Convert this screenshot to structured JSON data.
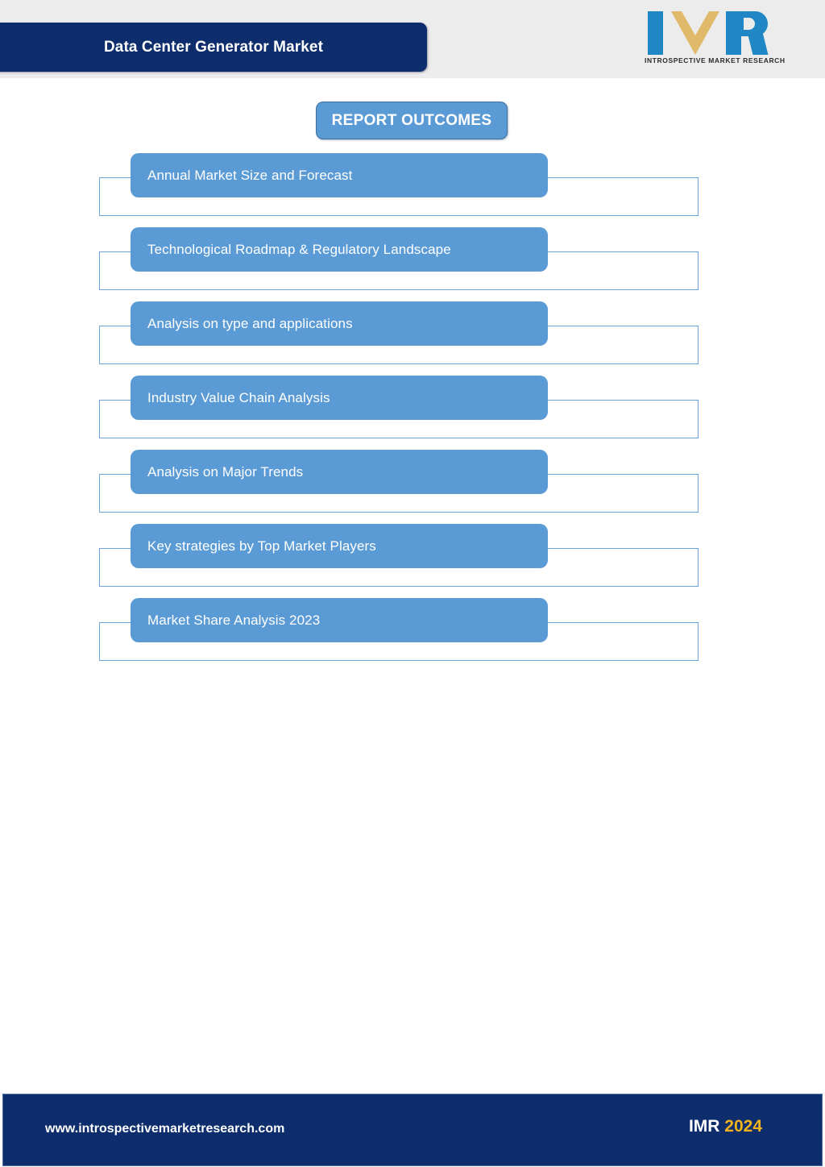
{
  "header": {
    "title": "Data Center Generator Market",
    "band_color": "#ececec",
    "title_color": "#0d2d6c"
  },
  "logo": {
    "letters": "IMR",
    "tagline": "INTROSPECTIVE MARKET RESEARCH",
    "blue": "#2186c4",
    "gold": "#e0b96a"
  },
  "section": {
    "heading": "REPORT OUTCOMES",
    "accent_color": "#5b9bd5"
  },
  "outcomes": [
    {
      "label": "Annual Market Size and Forecast"
    },
    {
      "label": "Technological Roadmap & Regulatory Landscape"
    },
    {
      "label": "Analysis on type and applications"
    },
    {
      "label": "Industry Value Chain Analysis"
    },
    {
      "label": "Analysis on Major Trends"
    },
    {
      "label": "Key strategies by Top Market Players"
    },
    {
      "label": "Market Share Analysis 2023"
    }
  ],
  "footer": {
    "url": "www.introspectivemarketresearch.com",
    "brand": "IMR",
    "year": "2024",
    "bar_color": "#0d2d6c",
    "year_color": "#f2b21c"
  }
}
